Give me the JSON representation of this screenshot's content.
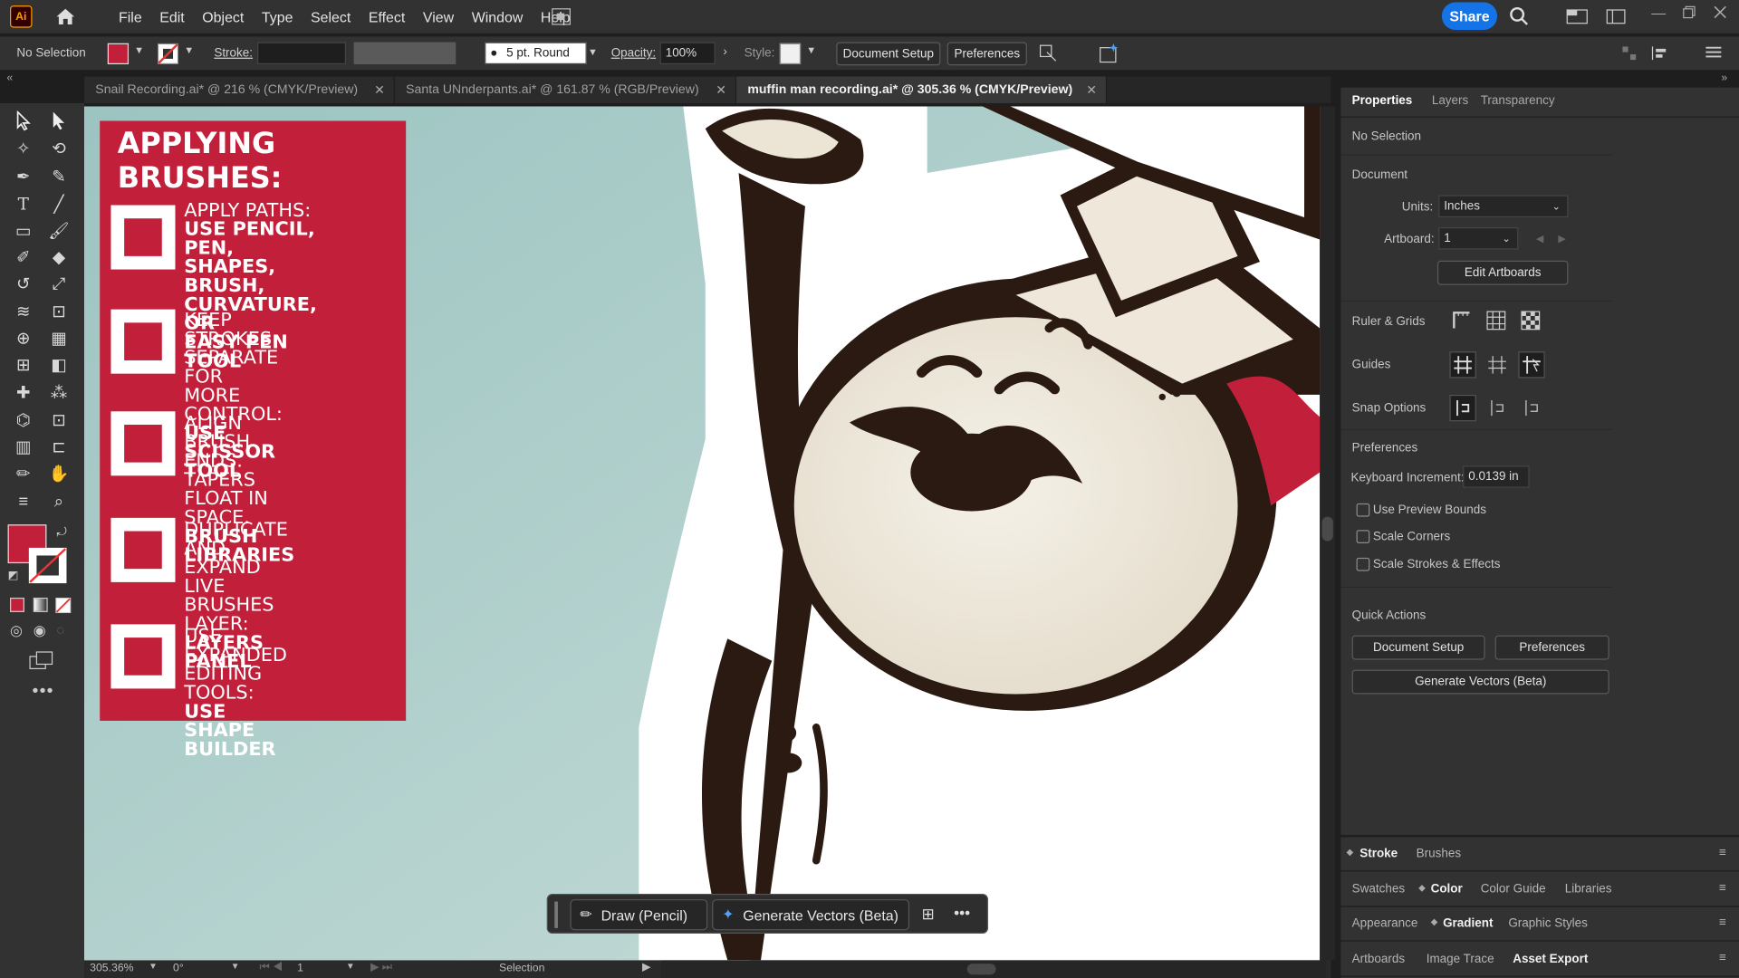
{
  "menubar": {
    "logo": "Ai",
    "items": [
      "File",
      "Edit",
      "Object",
      "Type",
      "Select",
      "Effect",
      "View",
      "Window",
      "Help"
    ],
    "share": "Share"
  },
  "control": {
    "selection": "No Selection",
    "stroke_label": "Stroke:",
    "brush": "5 pt. Round",
    "opacity_label": "Opacity:",
    "opacity": "100%",
    "style_label": "Style:",
    "doc_setup": "Document Setup",
    "preferences": "Preferences",
    "fill_color": "#c2203a"
  },
  "tabs": [
    {
      "label": "Snail Recording.ai* @ 216 % (CMYK/Preview)"
    },
    {
      "label": "Santa UNnderpants.ai* @ 161.87 % (RGB/Preview)"
    },
    {
      "label": "muffin man recording.ai* @ 305.36 % (CMYK/Preview)"
    }
  ],
  "card": {
    "title_line1": "APPLYING",
    "title_line2": "BRUSHES:",
    "items": [
      {
        "light": [
          "APPLY PATHS:"
        ],
        "bold": [
          "USE PENCIL, PEN,",
          "SHAPES, BRUSH,",
          "CURVATURE, OR",
          "EASY PEN TOOL"
        ]
      },
      {
        "light": [
          "KEEP STROKES",
          "SEPARATE FOR",
          "MORE CONTROL:"
        ],
        "bold": [
          "USE SCISSOR TOOL"
        ]
      },
      {
        "light": [
          "ALIGN BRUSH",
          "ENDS. TAPERS",
          "FLOAT IN SPACE."
        ],
        "bold": [
          "BRUSH LIBRARIES"
        ]
      },
      {
        "light": [
          "DUPLICATE AND",
          "EXPAND LIVE",
          "BRUSHES LAYER:"
        ],
        "bold": [
          "LAYERS PANEL"
        ]
      },
      {
        "light": [
          "USE EXPANDED",
          "EDITING TOOLS:"
        ],
        "bold": [
          "USE SHAPE BUILDER"
        ]
      }
    ]
  },
  "panel": {
    "tabs": [
      "Properties",
      "Layers",
      "Transparency"
    ],
    "selection": "No Selection",
    "document": "Document",
    "units_label": "Units:",
    "units": "Inches",
    "artboard_label": "Artboard:",
    "artboard": "1",
    "edit_artboards": "Edit Artboards",
    "ruler_grids": "Ruler & Grids",
    "guides": "Guides",
    "snap": "Snap Options",
    "preferences": "Preferences",
    "kbd_label": "Keyboard Increment:",
    "kbd": "0.0139 in",
    "chk1": "Use Preview Bounds",
    "chk2": "Scale Corners",
    "chk3": "Scale Strokes & Effects",
    "quick": "Quick Actions",
    "qa_doc": "Document Setup",
    "qa_pref": "Preferences",
    "qa_gen": "Generate Vectors (Beta)"
  },
  "bottom_panels": {
    "row1": [
      "Stroke",
      "Brushes"
    ],
    "row2": [
      "Swatches",
      "Color",
      "Color Guide",
      "Libraries"
    ],
    "row3": [
      "Appearance",
      "Gradient",
      "Graphic Styles"
    ],
    "row4": [
      "Artboards",
      "Image Trace",
      "Asset Export"
    ]
  },
  "floating": {
    "draw": "Draw (Pencil)",
    "generate": "Generate Vectors (Beta)"
  },
  "status": {
    "zoom": "305.36%",
    "angle": "0°",
    "artboard": "1",
    "mode": "Selection"
  }
}
